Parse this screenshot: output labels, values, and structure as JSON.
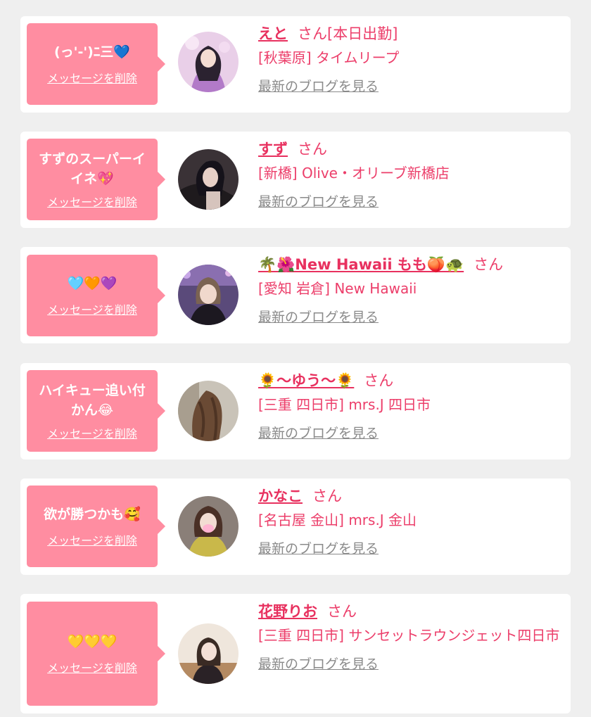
{
  "items": [
    {
      "message": "(っ'-')ﾆ三💙",
      "delete_label": "メッセージを削除",
      "name": "えと",
      "honorific": "さん[本日出勤]",
      "shop": "[秋葉原] タイムリープ",
      "blog_link": "最新のブログを見る",
      "avatar_icon": "avatar-photo-icon"
    },
    {
      "message": "すずのスーパーイイネ💖",
      "delete_label": "メッセージを削除",
      "name": "すず",
      "honorific": "さん",
      "shop": "[新橋] Olive・オリーブ新橋店",
      "blog_link": "最新のブログを見る",
      "avatar_icon": "avatar-photo-icon"
    },
    {
      "message": "🩵🧡💜",
      "delete_label": "メッセージを削除",
      "name": "🌴🌺New Hawaii もも🍑🐢",
      "honorific": "さん",
      "shop": "[愛知 岩倉] New Hawaii",
      "blog_link": "最新のブログを見る",
      "avatar_icon": "avatar-photo-icon"
    },
    {
      "message": "ハイキュー追い付かん😂",
      "delete_label": "メッセージを削除",
      "name": "🌻〜ゆう〜🌻",
      "honorific": "さん",
      "shop": "[三重 四日市] mrs.J 四日市",
      "blog_link": "最新のブログを見る",
      "avatar_icon": "avatar-photo-icon"
    },
    {
      "message": "欲が勝つかも🥰",
      "delete_label": "メッセージを削除",
      "name": "かなこ",
      "honorific": "さん",
      "shop": "[名古屋 金山] mrs.J 金山",
      "blog_link": "最新のブログを見る",
      "avatar_icon": "avatar-photo-icon"
    },
    {
      "message": "💛💛💛",
      "delete_label": "メッセージを削除",
      "name": "花野りお",
      "honorific": "さん",
      "shop": "[三重 四日市] サンセットラウンジェット四日市",
      "blog_link": "最新のブログを見る",
      "avatar_icon": "avatar-photo-icon"
    }
  ],
  "colors": {
    "background": "#efefef",
    "card": "#ffffff",
    "bubble": "#ff8da1",
    "accent_pink": "#e8315f",
    "link_gray": "#8a8a8a"
  }
}
